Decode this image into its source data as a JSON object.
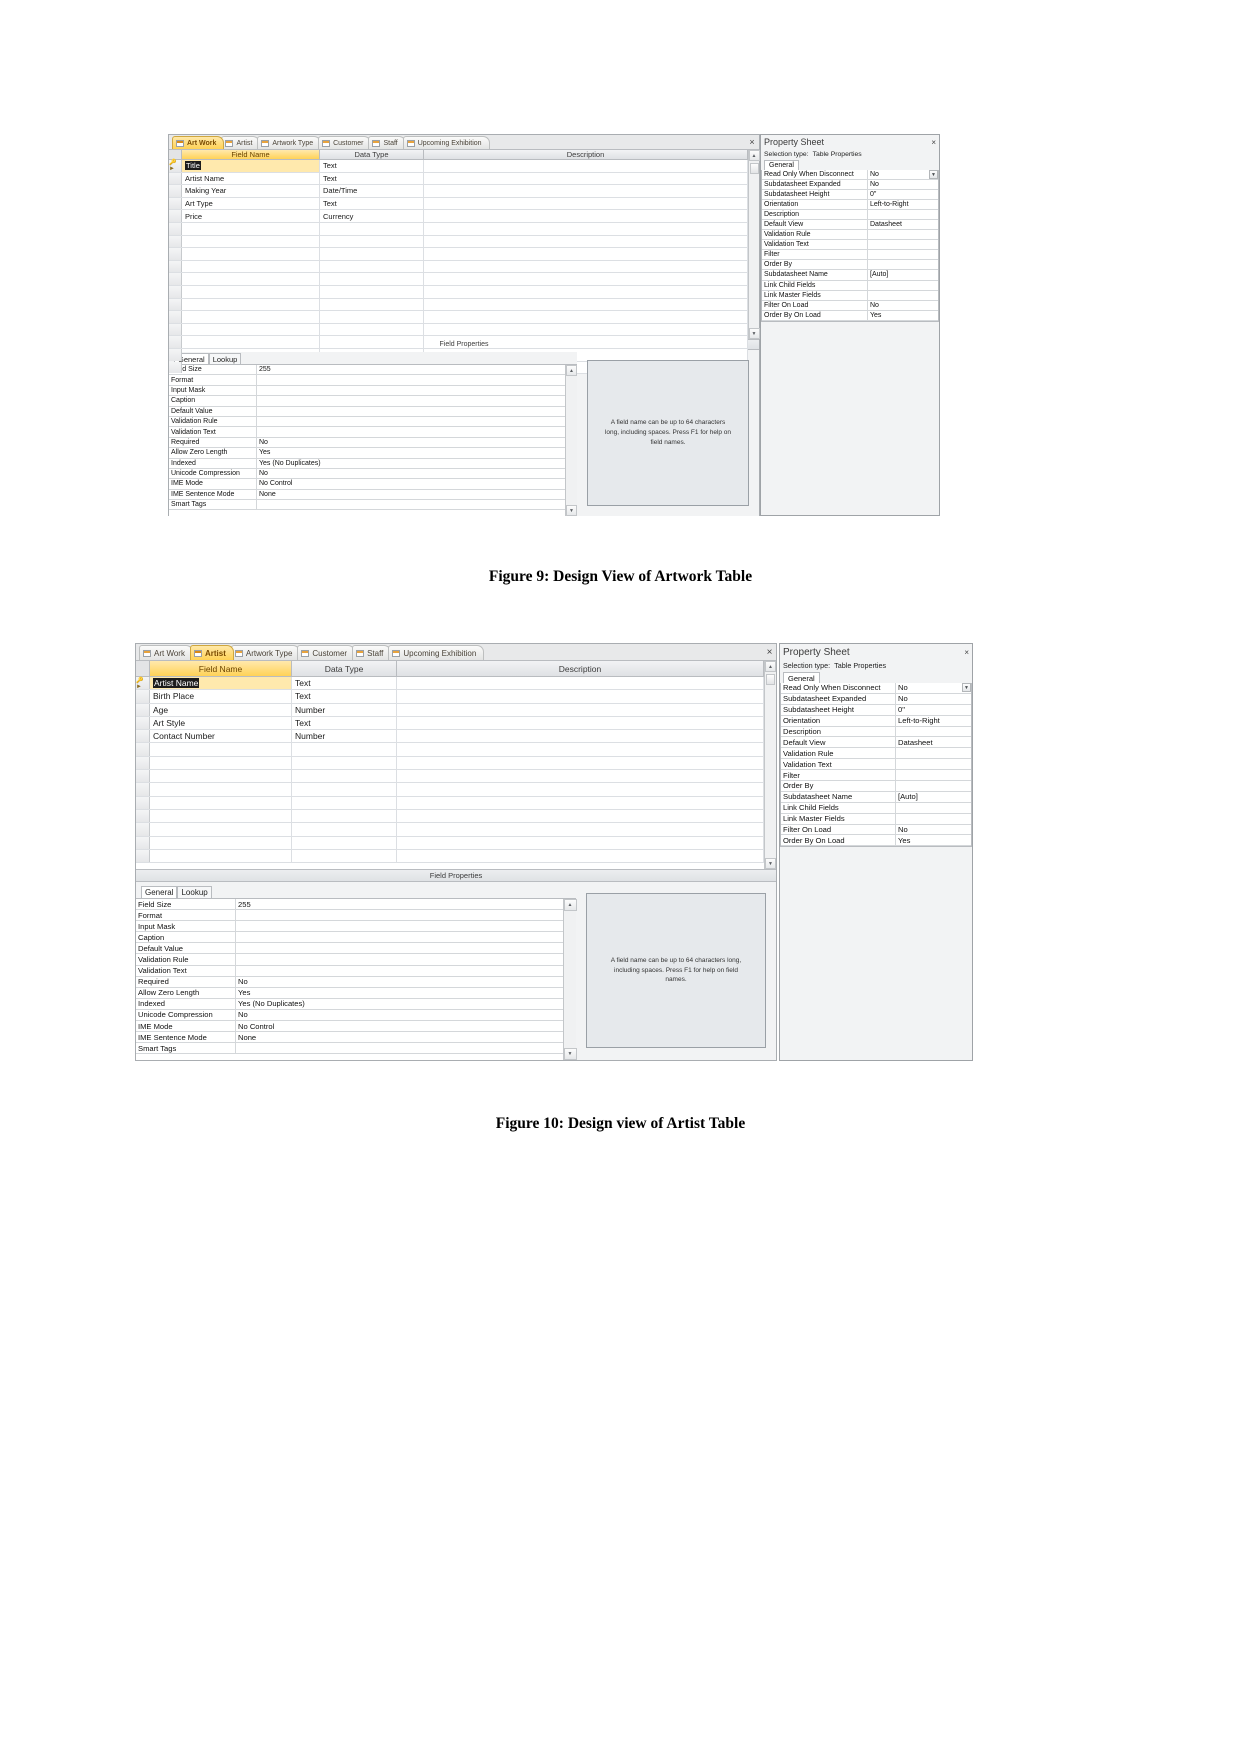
{
  "document": {
    "figure1": {
      "caption": "Figure 9: Design View of Artwork Table",
      "tabs": [
        {
          "label": "Art Work",
          "active": true
        },
        {
          "label": "Artist",
          "active": false
        },
        {
          "label": "Artwork Type",
          "active": false
        },
        {
          "label": "Customer",
          "active": false
        },
        {
          "label": "Staff",
          "active": false
        },
        {
          "label": "Upcoming Exhibition",
          "active": false
        }
      ],
      "close_label": "×",
      "grid": {
        "headers": [
          "Field Name",
          "Data Type",
          "Description"
        ],
        "rows": [
          {
            "key": true,
            "selected": true,
            "field": "Title",
            "type": "Text",
            "description": ""
          },
          {
            "key": false,
            "selected": false,
            "field": "Artist Name",
            "type": "Text",
            "description": ""
          },
          {
            "key": false,
            "selected": false,
            "field": "Making Year",
            "type": "Date/Time",
            "description": ""
          },
          {
            "key": false,
            "selected": false,
            "field": "Art Type",
            "type": "Text",
            "description": ""
          },
          {
            "key": false,
            "selected": false,
            "field": "Price",
            "type": "Currency",
            "description": ""
          }
        ],
        "empty_rows": 12
      },
      "field_properties": {
        "bar_label": "Field Properties",
        "tabs": [
          {
            "label": "General",
            "active": true
          },
          {
            "label": "Lookup",
            "active": false
          }
        ],
        "rows": [
          {
            "label": "Field Size",
            "value": "255"
          },
          {
            "label": "Format",
            "value": ""
          },
          {
            "label": "Input Mask",
            "value": ""
          },
          {
            "label": "Caption",
            "value": ""
          },
          {
            "label": "Default Value",
            "value": ""
          },
          {
            "label": "Validation Rule",
            "value": ""
          },
          {
            "label": "Validation Text",
            "value": ""
          },
          {
            "label": "Required",
            "value": "No"
          },
          {
            "label": "Allow Zero Length",
            "value": "Yes"
          },
          {
            "label": "Indexed",
            "value": "Yes (No Duplicates)"
          },
          {
            "label": "Unicode Compression",
            "value": "No"
          },
          {
            "label": "IME Mode",
            "value": "No Control"
          },
          {
            "label": "IME Sentence Mode",
            "value": "None"
          },
          {
            "label": "Smart Tags",
            "value": ""
          }
        ],
        "help_text": "A field name can be up to 64 characters long, including spaces. Press F1 for help on field names."
      },
      "property_sheet": {
        "title": "Property Sheet",
        "close_label": "×",
        "selection_type_label": "Selection type:",
        "selection_type_value": "Table Properties",
        "tab_label": "General",
        "rows": [
          {
            "label": "Read Only When Disconnect",
            "value": "No",
            "combo": true
          },
          {
            "label": "Subdatasheet Expanded",
            "value": "No",
            "combo": false
          },
          {
            "label": "Subdatasheet Height",
            "value": "0\"",
            "combo": false
          },
          {
            "label": "Orientation",
            "value": "Left-to-Right",
            "combo": false
          },
          {
            "label": "Description",
            "value": "",
            "combo": false
          },
          {
            "label": "Default View",
            "value": "Datasheet",
            "combo": false
          },
          {
            "label": "Validation Rule",
            "value": "",
            "combo": false
          },
          {
            "label": "Validation Text",
            "value": "",
            "combo": false
          },
          {
            "label": "Filter",
            "value": "",
            "combo": false
          },
          {
            "label": "Order By",
            "value": "",
            "combo": false
          },
          {
            "label": "Subdatasheet Name",
            "value": "[Auto]",
            "combo": false
          },
          {
            "label": "Link Child Fields",
            "value": "",
            "combo": false
          },
          {
            "label": "Link Master Fields",
            "value": "",
            "combo": false
          },
          {
            "label": "Filter On Load",
            "value": "No",
            "combo": false
          },
          {
            "label": "Order By On Load",
            "value": "Yes",
            "combo": false
          }
        ]
      }
    },
    "figure2": {
      "caption": "Figure 10: Design view of Artist Table",
      "tabs": [
        {
          "label": "Art Work",
          "active": false
        },
        {
          "label": "Artist",
          "active": true
        },
        {
          "label": "Artwork Type",
          "active": false
        },
        {
          "label": "Customer",
          "active": false
        },
        {
          "label": "Staff",
          "active": false
        },
        {
          "label": "Upcoming Exhibition",
          "active": false
        }
      ],
      "close_label": "×",
      "grid": {
        "headers": [
          "Field Name",
          "Data Type",
          "Description"
        ],
        "rows": [
          {
            "key": true,
            "selected": true,
            "field": "Artist Name",
            "type": "Text",
            "description": ""
          },
          {
            "key": false,
            "selected": false,
            "field": "Birth Place",
            "type": "Text",
            "description": ""
          },
          {
            "key": false,
            "selected": false,
            "field": "Age",
            "type": "Number",
            "description": ""
          },
          {
            "key": false,
            "selected": false,
            "field": "Art Style",
            "type": "Text",
            "description": ""
          },
          {
            "key": false,
            "selected": false,
            "field": "Contact Number",
            "type": "Number",
            "description": ""
          }
        ],
        "empty_rows": 9
      },
      "field_properties": {
        "bar_label": "Field Properties",
        "tabs": [
          {
            "label": "General",
            "active": true
          },
          {
            "label": "Lookup",
            "active": false
          }
        ],
        "rows": [
          {
            "label": "Field Size",
            "value": "255"
          },
          {
            "label": "Format",
            "value": ""
          },
          {
            "label": "Input Mask",
            "value": ""
          },
          {
            "label": "Caption",
            "value": ""
          },
          {
            "label": "Default Value",
            "value": ""
          },
          {
            "label": "Validation Rule",
            "value": ""
          },
          {
            "label": "Validation Text",
            "value": ""
          },
          {
            "label": "Required",
            "value": "No"
          },
          {
            "label": "Allow Zero Length",
            "value": "Yes"
          },
          {
            "label": "Indexed",
            "value": "Yes (No Duplicates)"
          },
          {
            "label": "Unicode Compression",
            "value": "No"
          },
          {
            "label": "IME Mode",
            "value": "No Control"
          },
          {
            "label": "IME Sentence Mode",
            "value": "None"
          },
          {
            "label": "Smart Tags",
            "value": ""
          }
        ],
        "help_text": "A field name can be up to 64 characters long, including spaces. Press F1 for help on field names."
      },
      "property_sheet": {
        "title": "Property Sheet",
        "close_label": "×",
        "selection_type_label": "Selection type:",
        "selection_type_value": "Table Properties",
        "tab_label": "General",
        "rows": [
          {
            "label": "Read Only When Disconnect",
            "value": "No",
            "combo": true
          },
          {
            "label": "Subdatasheet Expanded",
            "value": "No",
            "combo": false
          },
          {
            "label": "Subdatasheet Height",
            "value": "0\"",
            "combo": false
          },
          {
            "label": "Orientation",
            "value": "Left-to-Right",
            "combo": false
          },
          {
            "label": "Description",
            "value": "",
            "combo": false
          },
          {
            "label": "Default View",
            "value": "Datasheet",
            "combo": false
          },
          {
            "label": "Validation Rule",
            "value": "",
            "combo": false
          },
          {
            "label": "Validation Text",
            "value": "",
            "combo": false
          },
          {
            "label": "Filter",
            "value": "",
            "combo": false
          },
          {
            "label": "Order By",
            "value": "",
            "combo": false
          },
          {
            "label": "Subdatasheet Name",
            "value": "[Auto]",
            "combo": false
          },
          {
            "label": "Link Child Fields",
            "value": "",
            "combo": false
          },
          {
            "label": "Link Master Fields",
            "value": "",
            "combo": false
          },
          {
            "label": "Filter On Load",
            "value": "No",
            "combo": false
          },
          {
            "label": "Order By On Load",
            "value": "Yes",
            "combo": false
          }
        ]
      }
    }
  }
}
